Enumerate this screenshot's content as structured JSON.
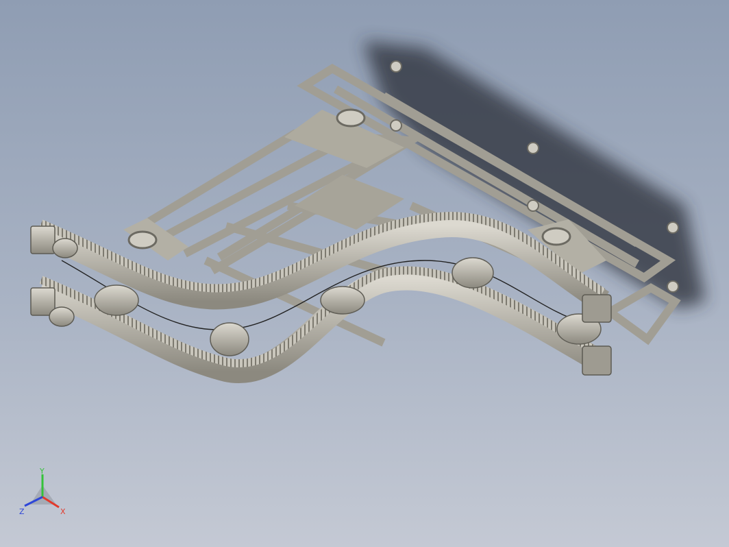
{
  "viewport": {
    "background_top": "#8f9db3",
    "background_bottom": "#c4c9d4"
  },
  "model": {
    "description_icon": "conveyor-assembly-3d-model",
    "part_color": "#b9b6ac",
    "shadow_color": "#2b2f38"
  },
  "triad": {
    "x_label": "X",
    "y_label": "Y",
    "z_label": "Z",
    "x_color": "#e23a2c",
    "y_color": "#35c23a",
    "z_color": "#2e46d8"
  }
}
